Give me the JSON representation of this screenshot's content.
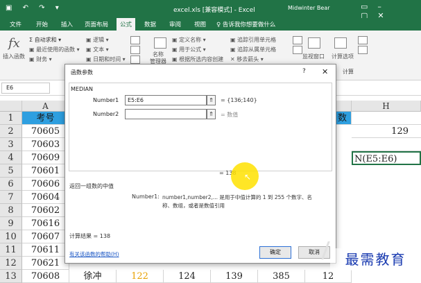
{
  "window": {
    "title": "excel.xls [兼容模式] - Excel",
    "user": "Midwinter Bear",
    "controls": [
      "▭",
      "–",
      "▢",
      "✕"
    ],
    "quick_access": "▣ ↶ ↷ ▾"
  },
  "tabs": [
    "文件",
    "开始",
    "插入",
    "页面布局",
    "公式",
    "数据",
    "审阅",
    "视图",
    "♀ 告诉我你想要做什么"
  ],
  "active_tab": "公式",
  "ribbon": {
    "insert_function": "插入函数",
    "autosum": "Σ 自动求和 ▾",
    "recent": "▣ 最近使用的函数 ▾",
    "financial": "▣ 财务 ▾",
    "logical": "▣ 逻辑 ▾",
    "text": "▣ 文本 ▾",
    "datetime": "▣ 日期和时间 ▾",
    "name_manager": "名称\n管理器",
    "define_name": "▣ 定义名称 ▾",
    "use_in_formula": "▣ 用于公式 ▾",
    "create_from_sel": "▣ 根据所选内容创建",
    "trace_precedents": "▣ 追踪引用单元格",
    "trace_dependents": "▣ 追踪从属单元格",
    "remove_arrows": "✕ 移去箭头 ▾",
    "watch_window": "监视窗口",
    "calc_options": "计算选项",
    "calc_group": "计算"
  },
  "namebox": "E6",
  "columns": {
    "A": "A",
    "H": "H"
  },
  "rows": [
    "1",
    "2",
    "3",
    "4",
    "5",
    "6",
    "7",
    "8",
    "9",
    "10",
    "11",
    "12",
    "13"
  ],
  "col_a_values": [
    "考号",
    "70605",
    "70603",
    "70609",
    "70601",
    "70606",
    "70604",
    "70602",
    "70616",
    "70607",
    "70611",
    "70621",
    "70608"
  ],
  "col_h_values": [
    "",
    "129",
    "",
    "N(E5:E6)"
  ],
  "partial_col_header": "数",
  "row13": {
    "name": "徐冲",
    "v1": "122",
    "v2": "124",
    "v3": "139",
    "v4": "385",
    "v5": "12"
  },
  "dialog": {
    "title": "函数参数",
    "help_q": "?",
    "close": "✕",
    "function_name": "MEDIAN",
    "args": [
      {
        "label": "Number1",
        "value": "E5:E6",
        "result": "= {136;140}"
      },
      {
        "label": "Number2",
        "value": "",
        "result": "= 数值"
      }
    ],
    "formula_result_inline": "= 138",
    "description": "返回一组数的中值",
    "arg_help_label": "Number1:",
    "arg_help_text": "number1,number2,... 是用于中值计算的 1 到 255 个数字、名称、数组，或者是数值引用",
    "calc_result": "计算结果 =  138",
    "help_link": "有关该函数的帮助(H)",
    "ok": "确定",
    "cancel": "取消"
  },
  "watermark": "最需教育"
}
